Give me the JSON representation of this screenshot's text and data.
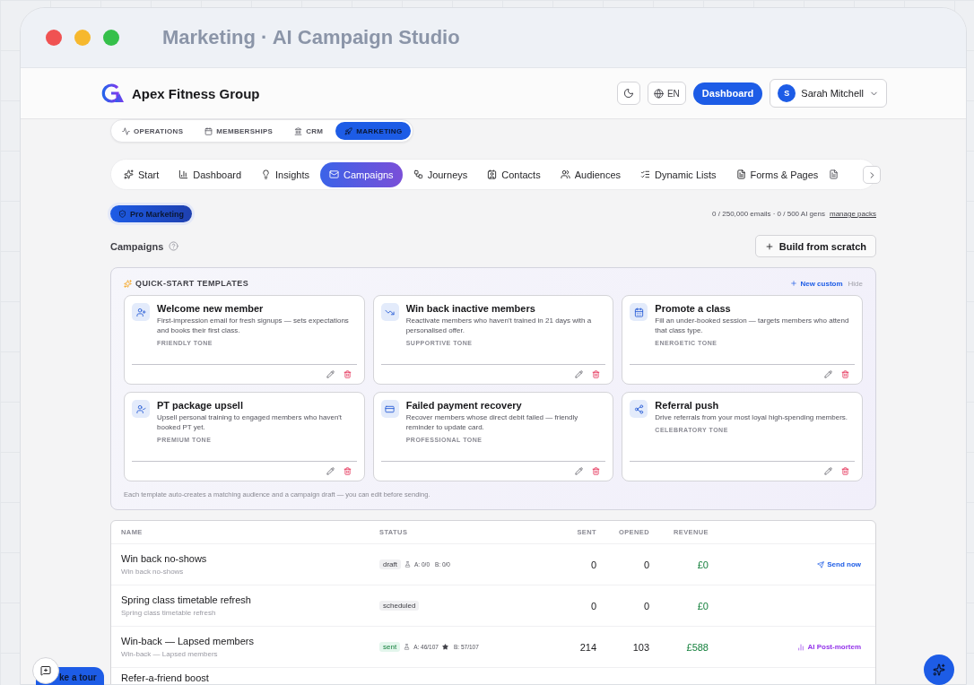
{
  "window": {
    "title": "Marketing · AI Campaign Studio"
  },
  "header": {
    "brand": "Apex Fitness Group",
    "language": "EN",
    "dashboard_button": "Dashboard",
    "user": {
      "initial": "S",
      "name": "Sarah Mitchell"
    }
  },
  "module_tabs": [
    {
      "label": "OPERATIONS",
      "selected": false
    },
    {
      "label": "MEMBERSHIPS",
      "selected": false
    },
    {
      "label": "CRM",
      "selected": false
    },
    {
      "label": "MARKETING",
      "selected": true
    }
  ],
  "section_tabs": [
    {
      "label": "Start",
      "selected": false
    },
    {
      "label": "Dashboard",
      "selected": false
    },
    {
      "label": "Insights",
      "selected": false
    },
    {
      "label": "Campaigns",
      "selected": true
    },
    {
      "label": "Journeys",
      "selected": false
    },
    {
      "label": "Contacts",
      "selected": false
    },
    {
      "label": "Audiences",
      "selected": false
    },
    {
      "label": "Dynamic Lists",
      "selected": false
    },
    {
      "label": "Forms & Pages",
      "selected": false
    }
  ],
  "plan_badge": "Pro Marketing",
  "usage": "0 / 250,000 emails · 0 / 500 AI gens",
  "manage_link": "manage packs",
  "page_title": "Campaigns",
  "build_button": "Build from scratch",
  "templates": {
    "title": "QUICK-START TEMPLATES",
    "new_custom": "New custom",
    "hide": "Hide",
    "items": [
      {
        "title": "Welcome new member",
        "description": "First-impression email for fresh signups — sets expectations and books their first class.",
        "tone": "FRIENDLY TONE"
      },
      {
        "title": "Win back inactive members",
        "description": "Reactivate members who haven't trained in 21 days with a personalised offer.",
        "tone": "SUPPORTIVE TONE"
      },
      {
        "title": "Promote a class",
        "description": "Fill an under-booked session — targets members who attend that class type.",
        "tone": "ENERGETIC TONE"
      },
      {
        "title": "PT package upsell",
        "description": "Upsell personal training to engaged members who haven't booked PT yet.",
        "tone": "PREMIUM TONE"
      },
      {
        "title": "Failed payment recovery",
        "description": "Recover members whose direct debit failed — friendly reminder to update card.",
        "tone": "PROFESSIONAL TONE"
      },
      {
        "title": "Referral push",
        "description": "Drive referrals from your most loyal high-spending members.",
        "tone": "CELEBRATORY TONE"
      }
    ],
    "footnote": "Each template auto-creates a matching audience and a campaign draft — you can edit before sending."
  },
  "table": {
    "columns": [
      "NAME",
      "STATUS",
      "SENT",
      "OPENED",
      "REVENUE"
    ],
    "rows": [
      {
        "name": "Win back no-shows",
        "subtitle": "Win back no-shows",
        "status": "draft",
        "ab": {
          "a": "A: 0/0",
          "b": "B: 0/0",
          "a_winner": false
        },
        "sent": "0",
        "opened": "0",
        "revenue": "£0",
        "action": {
          "kind": "send",
          "label": "Send now"
        }
      },
      {
        "name": "Spring class timetable refresh",
        "subtitle": "Spring class timetable refresh",
        "status": "scheduled",
        "sent": "0",
        "opened": "0",
        "revenue": "£0"
      },
      {
        "name": "Win-back — Lapsed members",
        "subtitle": "Win-back — Lapsed members",
        "status": "sent",
        "ab": {
          "a": "A: 46/107",
          "b": "B: 57/107",
          "a_winner": true
        },
        "sent": "214",
        "opened": "103",
        "revenue": "£588",
        "action": {
          "kind": "postmortem",
          "label": "AI Post-mortem"
        }
      },
      {
        "name": "Refer-a-friend boost"
      }
    ]
  },
  "tour_button": "ke a tour"
}
